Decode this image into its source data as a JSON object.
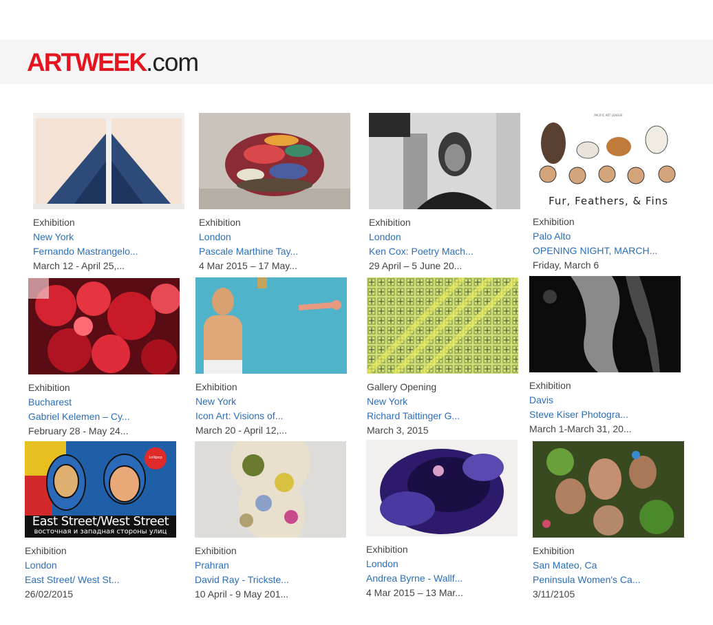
{
  "header": {
    "logo_brand": "ARTWEEK",
    "logo_tld": ".com"
  },
  "cards": [
    {
      "type": "Exhibition",
      "location": "New York",
      "title": "Fernando Mastrangelo...",
      "date": "March 12 - April 25,..."
    },
    {
      "type": "Exhibition",
      "location": "London",
      "title": "Pascale Marthine Tay...",
      "date": "4 Mar 2015 – 17 May..."
    },
    {
      "type": "Exhibition",
      "location": "London",
      "title": "Ken Cox: Poetry Mach...",
      "date": "29 April – 5 June 20..."
    },
    {
      "type": "Exhibition",
      "location": "Palo Alto",
      "title": "OPENING NIGHT, MARCH...",
      "date": "Friday, March 6",
      "image_text": "Fur, Feathers, & Fins",
      "image_subtext": "PACIFIC ART LEAGUE"
    },
    {
      "type": "Exhibition",
      "location": "Bucharest",
      "title": "Gabriel Kelemen – Cy...",
      "date": "February 28 - May 24..."
    },
    {
      "type": "Exhibition",
      "location": "New York",
      "title": "Icon Art: Visions of...",
      "date": "March 20 - April 12,..."
    },
    {
      "type": "Gallery Opening",
      "location": "New York",
      "title": "Richard Taittinger G...",
      "date": "March 3, 2015"
    },
    {
      "type": "Exhibition",
      "location": "Davis",
      "title": "Steve Kiser Photogra...",
      "date": "March 1-March 31, 20..."
    },
    {
      "type": "Exhibition",
      "location": "London",
      "title": "East Street/ West St...",
      "date": "26/02/2015",
      "image_text": "East Street/West Street",
      "image_subtext": "восточная и западная стороны улиц",
      "image_badge": "Lollipop"
    },
    {
      "type": "Exhibition",
      "location": "Prahran",
      "title": "David Ray - Trickste...",
      "date": "10 April - 9 May 201..."
    },
    {
      "type": "Exhibition",
      "location": "London",
      "title": "Andrea Byrne - Wallf...",
      "date": "4 Mar 2015 – 13 Mar..."
    },
    {
      "type": "Exhibition",
      "location": "San Mateo, Ca",
      "title": "Peninsula Women's Ca...",
      "date": "3/11/2105"
    }
  ]
}
